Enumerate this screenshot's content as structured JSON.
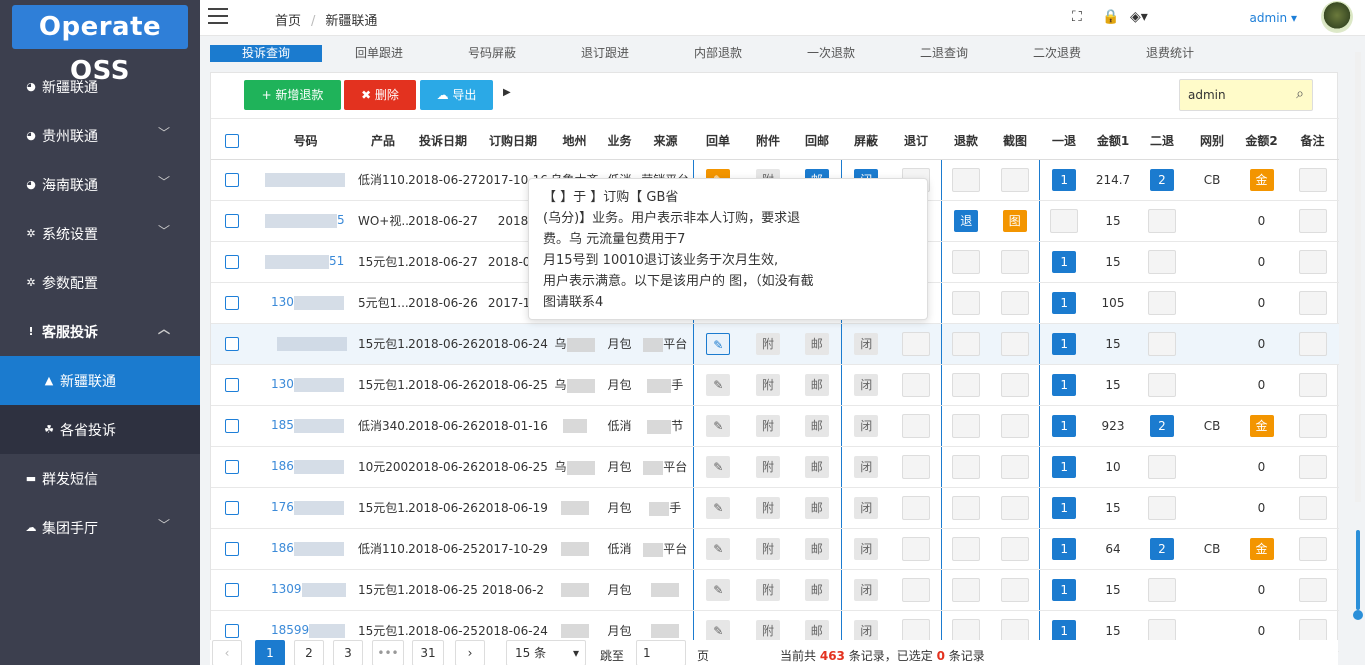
{
  "app": {
    "logo": "Operate OSS",
    "user": "admin"
  },
  "sidebar": {
    "items": [
      {
        "label": "新疆联通",
        "icon": "dot-icon"
      },
      {
        "label": "贵州联通",
        "icon": "dot-icon"
      },
      {
        "label": "海南联通",
        "icon": "dot-icon"
      },
      {
        "label": "系统设置",
        "icon": "gear-icon"
      },
      {
        "label": "参数配置",
        "icon": "gear-icon"
      },
      {
        "label": "客服投诉",
        "icon": "exclamation-icon"
      },
      {
        "label": "新疆联通",
        "icon": "warning-icon"
      },
      {
        "label": "各省投诉",
        "icon": "cubes-icon"
      },
      {
        "label": "群发短信",
        "icon": "sms-icon"
      },
      {
        "label": "集团手厅",
        "icon": "cloud-icon"
      }
    ]
  },
  "breadcrumb": {
    "home": "首页",
    "current": "新疆联通"
  },
  "tabs": [
    "投诉查询",
    "回单跟进",
    "号码屏蔽",
    "退订跟进",
    "内部退款",
    "一次退款",
    "二退查询",
    "二次退费",
    "退费统计"
  ],
  "toolbar": {
    "add": "+ 新增退款",
    "del": "✖ 删除",
    "export": "☁ 导出",
    "search_value": "admin"
  },
  "table": {
    "headers": [
      "号码",
      "产品",
      "投诉日期",
      "订购日期",
      "地州",
      "业务",
      "来源",
      "回单",
      "附件",
      "回邮",
      "屏蔽",
      "退订",
      "退款",
      "截图",
      "一退",
      "金额1",
      "二退",
      "网别",
      "金额2",
      "备注"
    ],
    "rows": [
      {
        "phone": "",
        "product": "低消110...",
        "cdate": "2018-06-27",
        "odate": "2017-10-16",
        "area": "乌鲁木齐",
        "biz": "低消",
        "src": "营销平台",
        "amt1": "214.7",
        "nt": "CB"
      },
      {
        "phone": "5",
        "product": "WO+视...",
        "cdate": "2018-06-27",
        "odate": "2018",
        "area": "",
        "biz": "",
        "src": "",
        "amt1": "15",
        "nt": ""
      },
      {
        "phone": "51",
        "product": "15元包1...",
        "cdate": "2018-06-27",
        "odate": "2018-06",
        "area": "",
        "biz": "",
        "src": "",
        "amt1": "15",
        "nt": ""
      },
      {
        "phone": "130",
        "product": "5元包1...",
        "cdate": "2018-06-26",
        "odate": "2017-12",
        "area": "",
        "biz": "",
        "src": "",
        "amt1": "105",
        "nt": ""
      },
      {
        "phone": "",
        "product": "15元包1...",
        "cdate": "2018-06-26",
        "odate": "2018-06-24",
        "area": "乌",
        "biz": "月包",
        "src": "平台",
        "amt1": "15",
        "nt": ""
      },
      {
        "phone": "130",
        "product": "15元包1...",
        "cdate": "2018-06-26",
        "odate": "2018-06-25",
        "area": "乌",
        "biz": "月包",
        "src": "手",
        "amt1": "15",
        "nt": ""
      },
      {
        "phone": "185",
        "product": "低消340...",
        "cdate": "2018-06-26",
        "odate": "2018-01-16",
        "area": "",
        "biz": "低消",
        "src": "节",
        "amt1": "923",
        "nt": "CB"
      },
      {
        "phone": "186",
        "product": "10元200...",
        "cdate": "2018-06-26",
        "odate": "2018-06-25",
        "area": "乌",
        "biz": "月包",
        "src": "平台",
        "amt1": "10",
        "nt": ""
      },
      {
        "phone": "176",
        "product": "15元包1...",
        "cdate": "2018-06-26",
        "odate": "2018-06-19",
        "area": "",
        "biz": "月包",
        "src": "手",
        "amt1": "15",
        "nt": ""
      },
      {
        "phone": "186",
        "product": "低消110...",
        "cdate": "2018-06-25",
        "odate": "2017-10-29",
        "area": "",
        "biz": "低消",
        "src": "平台",
        "amt1": "64",
        "nt": "CB"
      },
      {
        "phone": "1309",
        "product": "15元包1...",
        "cdate": "2018-06-25",
        "odate": "2018-06-2",
        "area": "",
        "biz": "月包",
        "src": "",
        "amt1": "15",
        "nt": ""
      },
      {
        "phone": "18599",
        "product": "15元包1...",
        "cdate": "2018-06-25",
        "odate": "2018-06-24",
        "area": "",
        "biz": "月包",
        "src": "",
        "amt1": "15",
        "nt": ""
      }
    ]
  },
  "tooltip": {
    "lines": [
      "【 】于 】订购【 GB省",
      "(乌分)】业务。用户表示非本人订购，要求退",
      "费。乌 元流量包费用于7",
      "月15号到 10010退订该业务于次月生效,",
      "用户表示满意。以下是该用户的 图，（如没有截",
      "图请联系4"
    ]
  },
  "pager": {
    "pages": [
      "1",
      "2",
      "3",
      "•••",
      "31"
    ],
    "page_size": "15 条",
    "goto": "跳至",
    "goto_value": "1",
    "page_unit": "页",
    "total_text": "当前共",
    "total": "463",
    "total_unit": "条记录，已选定",
    "selected": "0",
    "selected_unit": "条记录"
  },
  "labels": {
    "bad": "退",
    "img": "图",
    "n1": "1",
    "n2": "2",
    "gold": "金",
    "fu": "附",
    "you": "邮",
    "bi": "闭",
    "zero": "0"
  }
}
